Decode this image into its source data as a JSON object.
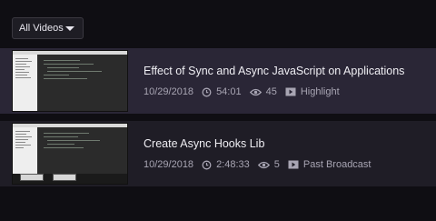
{
  "filter": {
    "label": "All Videos"
  },
  "videos": [
    {
      "title": "Effect of Sync and Async JavaScript on Applications",
      "date": "10/29/2018",
      "duration": "54:01",
      "views": "45",
      "type": "Highlight"
    },
    {
      "title": "Create Async Hooks Lib",
      "date": "10/29/2018",
      "duration": "2:48:33",
      "views": "5",
      "type": "Past Broadcast"
    }
  ],
  "colors": {
    "background": "#0f0e13",
    "selected_card": "#2a2636",
    "card": "#1f1d26",
    "title_text": "#efeef3",
    "meta_text": "#a8a5b3"
  },
  "icons": [
    "chevron-down-icon",
    "clock-icon",
    "eye-icon",
    "video-type-icon"
  ]
}
